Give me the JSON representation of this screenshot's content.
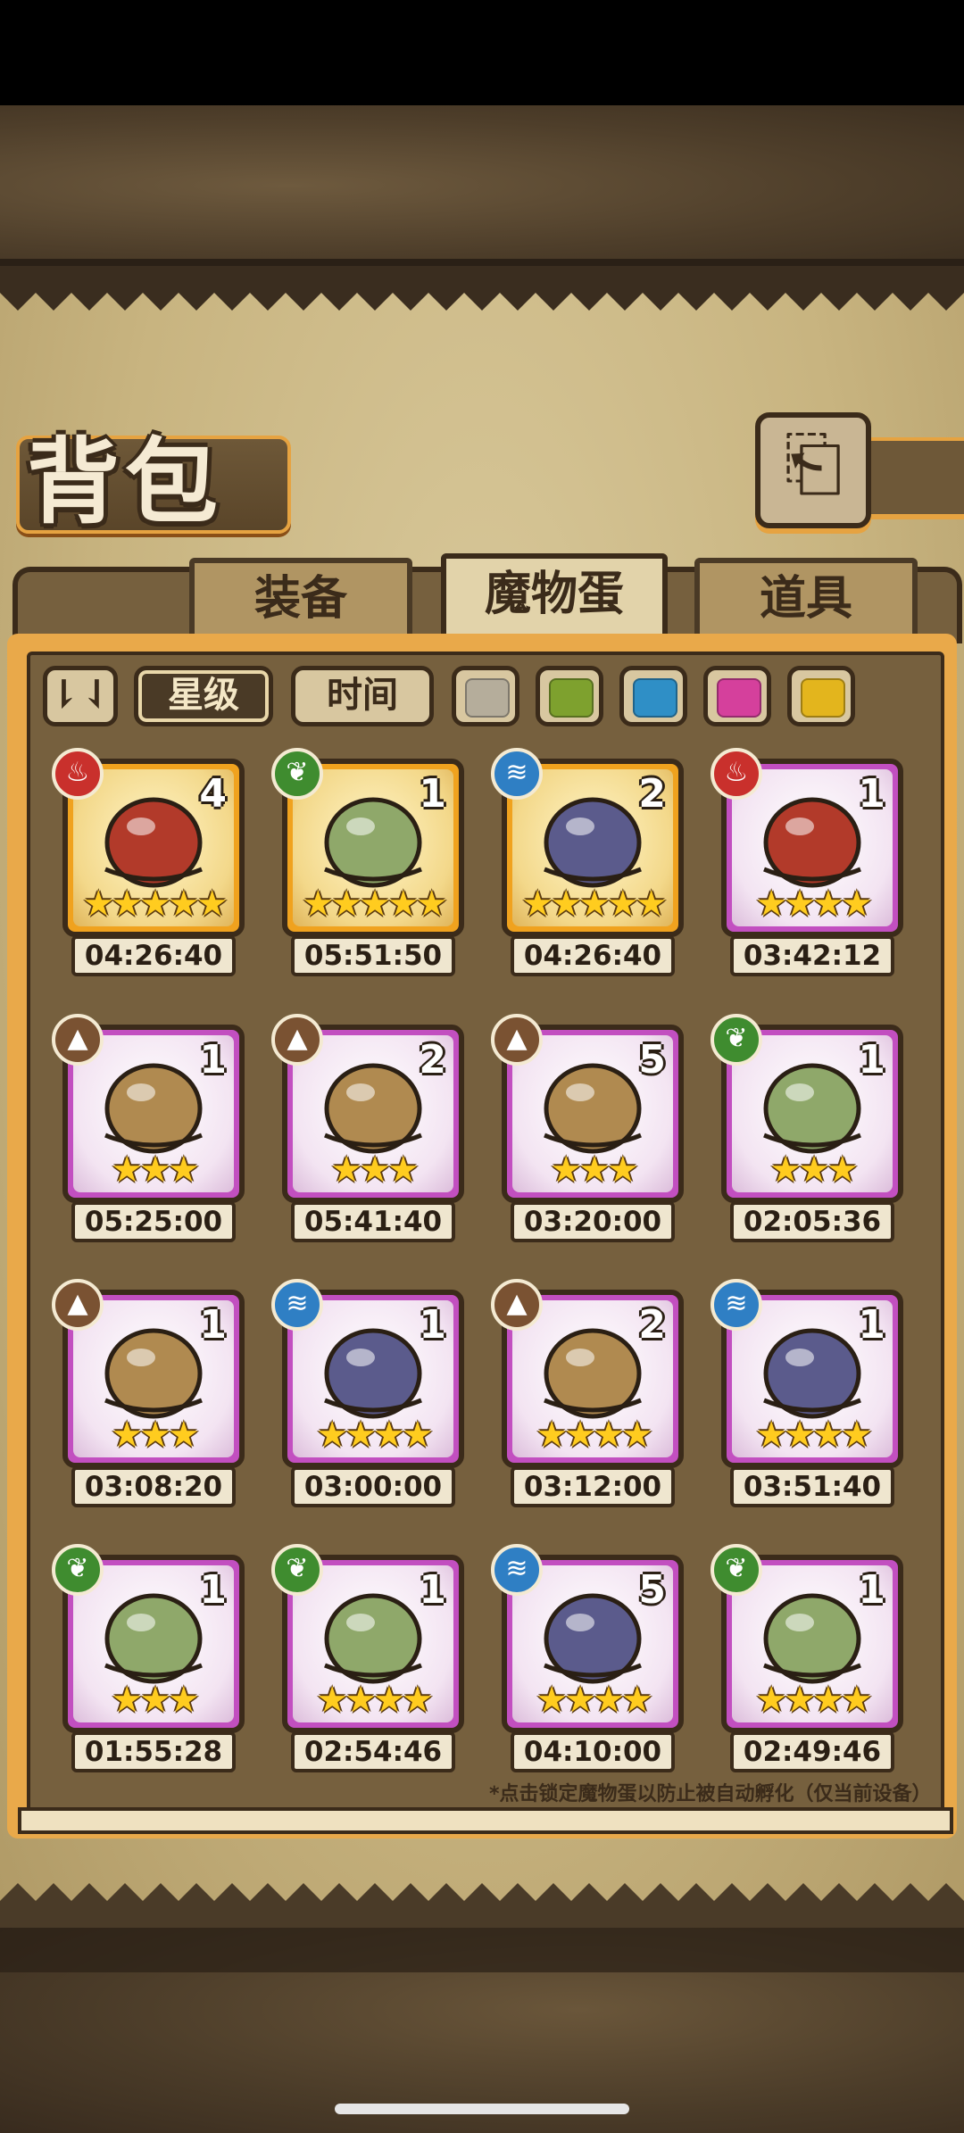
{
  "header": {
    "title": "背包",
    "back_icon": "back-arrow-icon"
  },
  "tabs": [
    {
      "label": "装备",
      "active": false
    },
    {
      "label": "魔物蛋",
      "active": true
    },
    {
      "label": "道具",
      "active": false
    }
  ],
  "filters": {
    "sort_icon": "sort-toggle-icon",
    "sort_star": "星级",
    "sort_time": "时间",
    "colors": [
      "#b5ad9b",
      "#7ea12e",
      "#2f8fc6",
      "#d5409c",
      "#e3b51d"
    ]
  },
  "eggs": [
    {
      "element": "fire",
      "count": "4",
      "stars": "★★★★★",
      "timer": "04:26:40",
      "rarity": "gold",
      "art": "bow-quiver-egg"
    },
    {
      "element": "leaf",
      "count": "1",
      "stars": "★★★★★",
      "timer": "05:51:50",
      "rarity": "gold",
      "art": "lantern-chain-egg"
    },
    {
      "element": "water",
      "count": "2",
      "stars": "★★★★★",
      "timer": "04:26:40",
      "rarity": "gold",
      "art": "dark-feather-egg"
    },
    {
      "element": "fire",
      "count": "1",
      "stars": "★★★★",
      "timer": "03:42:12",
      "rarity": "purple",
      "art": "red-horned-egg"
    },
    {
      "element": "earth",
      "count": "1",
      "stars": "★★★",
      "timer": "05:25:00",
      "rarity": "purple",
      "art": "golden-fur-egg"
    },
    {
      "element": "earth",
      "count": "2",
      "stars": "★★★",
      "timer": "05:41:40",
      "rarity": "purple",
      "art": "pink-thorn-egg"
    },
    {
      "element": "earth",
      "count": "5",
      "stars": "★★★",
      "timer": "03:20:00",
      "rarity": "purple",
      "art": "sword-gauntlet-egg"
    },
    {
      "element": "leaf",
      "count": "1",
      "stars": "★★★",
      "timer": "02:05:36",
      "rarity": "purple",
      "art": "spiked-helmet-egg"
    },
    {
      "element": "earth",
      "count": "1",
      "stars": "★★★",
      "timer": "03:08:20",
      "rarity": "purple",
      "art": "horn-fur-egg"
    },
    {
      "element": "water",
      "count": "1",
      "stars": "★★★★",
      "timer": "03:00:00",
      "rarity": "purple",
      "art": "hooded-egg"
    },
    {
      "element": "earth",
      "count": "2",
      "stars": "★★★★",
      "timer": "03:12:00",
      "rarity": "purple",
      "art": "cracked-white-egg"
    },
    {
      "element": "water",
      "count": "1",
      "stars": "★★★★",
      "timer": "03:51:40",
      "rarity": "purple",
      "art": "panda-hammer-egg"
    },
    {
      "element": "leaf",
      "count": "1",
      "stars": "★★★",
      "timer": "01:55:28",
      "rarity": "purple",
      "art": "leafy-pale-egg"
    },
    {
      "element": "leaf",
      "count": "1",
      "stars": "★★★★",
      "timer": "02:54:46",
      "rarity": "purple",
      "art": "striped-leaf-egg"
    },
    {
      "element": "water",
      "count": "5",
      "stars": "★★★★",
      "timer": "04:10:00",
      "rarity": "purple",
      "art": "slime-egg"
    },
    {
      "element": "leaf",
      "count": "1",
      "stars": "★★★★",
      "timer": "02:49:46",
      "rarity": "purple",
      "art": "butterfly-egg"
    }
  ],
  "element_colors": {
    "fire": "#c9302c",
    "leaf": "#3f8c2f",
    "water": "#2f7fc4",
    "earth": "#7a5232"
  },
  "element_glyphs": {
    "fire": "♨",
    "leaf": "❦",
    "water": "≋",
    "earth": "▲"
  },
  "rarity_colors": {
    "gold": "#f0a21e",
    "purple": "#c24fc0"
  },
  "footer_note": "*点击锁定魔物蛋以防止被自动孵化（仅当前设备）"
}
